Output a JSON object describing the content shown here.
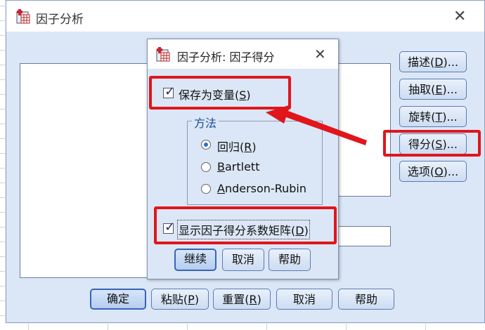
{
  "main_dialog": {
    "title": "因子分析",
    "close_glyph": "✕",
    "side_buttons": [
      {
        "text": "描述(",
        "key": "D",
        "suffix": ")..."
      },
      {
        "text": "抽取(",
        "key": "E",
        "suffix": ")..."
      },
      {
        "text": "旋转(",
        "key": "T",
        "suffix": ")..."
      },
      {
        "text": "得分(",
        "key": "S",
        "suffix": ")..."
      },
      {
        "text": "选项(",
        "key": "O",
        "suffix": ")..."
      }
    ],
    "bottom_buttons": {
      "ok": "确定",
      "paste": {
        "text": "粘贴(",
        "key": "P",
        "suffix": ")"
      },
      "reset": {
        "text": "重置(",
        "key": "R",
        "suffix": ")"
      },
      "cancel": "取消",
      "help": "帮助"
    }
  },
  "sub_dialog": {
    "title": "因子分析: 因子得分",
    "close_glyph": "✕",
    "save_as_variable": {
      "text": "保存为变量(",
      "key": "S",
      "suffix": ")",
      "checked": true
    },
    "method_group": {
      "title": "方法",
      "options": [
        {
          "text": "回归(",
          "key": "R",
          "suffix": ")",
          "selected": true
        },
        {
          "text": "",
          "key": "B",
          "suffix": "artlett",
          "selected": false
        },
        {
          "text": "",
          "key": "A",
          "suffix": "nderson-Rubin",
          "selected": false
        }
      ]
    },
    "show_matrix": {
      "text": "显示因子得分系数矩阵(",
      "key": "D",
      "suffix": ")",
      "checked": true
    },
    "buttons": {
      "continue": "继续",
      "cancel": "取消",
      "help": "帮助"
    }
  },
  "colors": {
    "annotation_red": "#e0161b",
    "dialog_bg": "#dbe7f6"
  },
  "icons": {
    "app": "spss-table-icon",
    "check": "checkmark-icon"
  }
}
